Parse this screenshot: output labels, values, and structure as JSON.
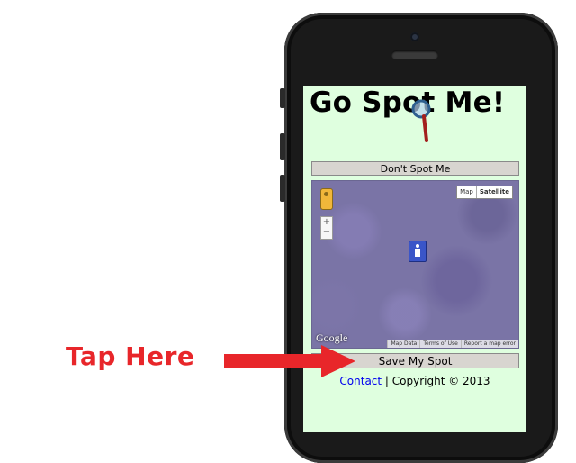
{
  "app": {
    "title": "Go Spot Me!"
  },
  "buttons": {
    "dont_spot_me": "Don't Spot Me",
    "save_my_spot": "Save My Spot"
  },
  "map": {
    "map_type": [
      "Map",
      "Satellite"
    ],
    "zoom_in": "+",
    "zoom_out": "−",
    "logo": "Google",
    "footer_links": [
      "Map Data",
      "Terms of Use",
      "Report a map error"
    ]
  },
  "footer": {
    "contact_link": "Contact",
    "separator": " | ",
    "copyright": "Copyright © 2013"
  },
  "annotation": {
    "label": "Tap Here",
    "color": "#e8262a"
  },
  "colors": {
    "screen_bg": "#dfffdf",
    "button_bg": "#d8d5d0",
    "link": "#0000ee",
    "phone_body": "#1a1a1a"
  }
}
